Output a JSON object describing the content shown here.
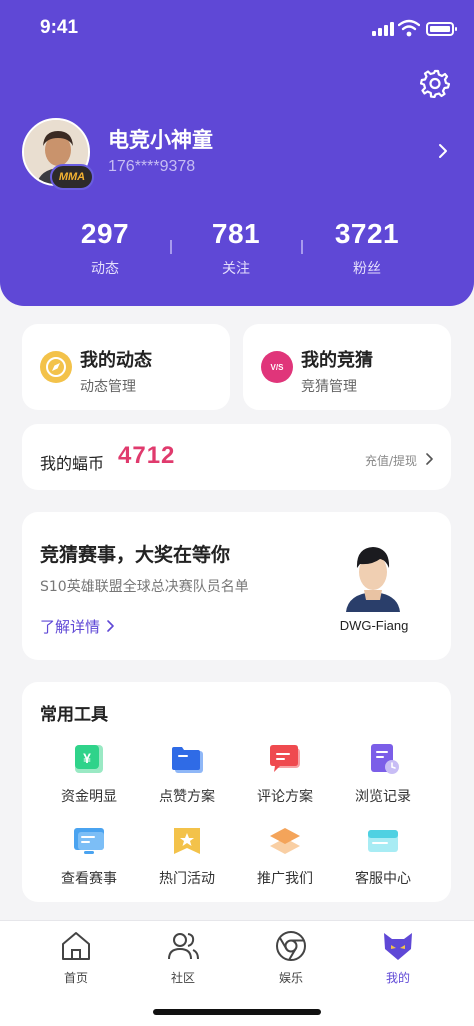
{
  "status_bar": {
    "time": "9:41"
  },
  "profile": {
    "name": "电竞小神童",
    "phone": "176****9378",
    "badge": "MMA",
    "stats": [
      {
        "value": "297",
        "label": "动态"
      },
      {
        "value": "781",
        "label": "关注"
      },
      {
        "value": "3721",
        "label": "粉丝"
      }
    ]
  },
  "quick_links": [
    {
      "title": "我的动态",
      "subtitle": "动态管理",
      "icon": "compass-icon"
    },
    {
      "title": "我的竞猜",
      "subtitle": "竞猜管理",
      "icon": "vs-icon",
      "icon_text": "V/S"
    }
  ],
  "coins": {
    "label": "我的蝠币",
    "value": "4712",
    "action": "充值/提现"
  },
  "promo": {
    "title": "竞猜赛事，大奖在等你",
    "subtitle": "S10英雄联盟全球总决赛队员名单",
    "link": "了解详情",
    "player_name": "DWG-Fiang"
  },
  "tools": {
    "title": "常用工具",
    "items": [
      {
        "label": "资金明显",
        "icon": "yen-wallet-icon",
        "color": "#2fd38a",
        "glyph": "¥"
      },
      {
        "label": "点赞方案",
        "icon": "folder-icon",
        "color": "#2f6be6"
      },
      {
        "label": "评论方案",
        "icon": "comment-icon",
        "color": "#ef4a4f"
      },
      {
        "label": "浏览记录",
        "icon": "history-doc-icon",
        "color": "#7b5ee8"
      },
      {
        "label": "查看赛事",
        "icon": "monitor-icon",
        "color": "#4aa3f0"
      },
      {
        "label": "热门活动",
        "icon": "star-badge-icon",
        "color": "#f3c24a"
      },
      {
        "label": "推广我们",
        "icon": "layers-icon",
        "color": "#f4a45a"
      },
      {
        "label": "客服中心",
        "icon": "service-screen-icon",
        "color": "#4fd1e2"
      }
    ]
  },
  "tabbar": {
    "items": [
      {
        "label": "首页",
        "icon": "home-icon"
      },
      {
        "label": "社区",
        "icon": "community-icon"
      },
      {
        "label": "娱乐",
        "icon": "chrome-icon"
      },
      {
        "label": "我的",
        "icon": "fox-icon",
        "active": true
      }
    ]
  }
}
